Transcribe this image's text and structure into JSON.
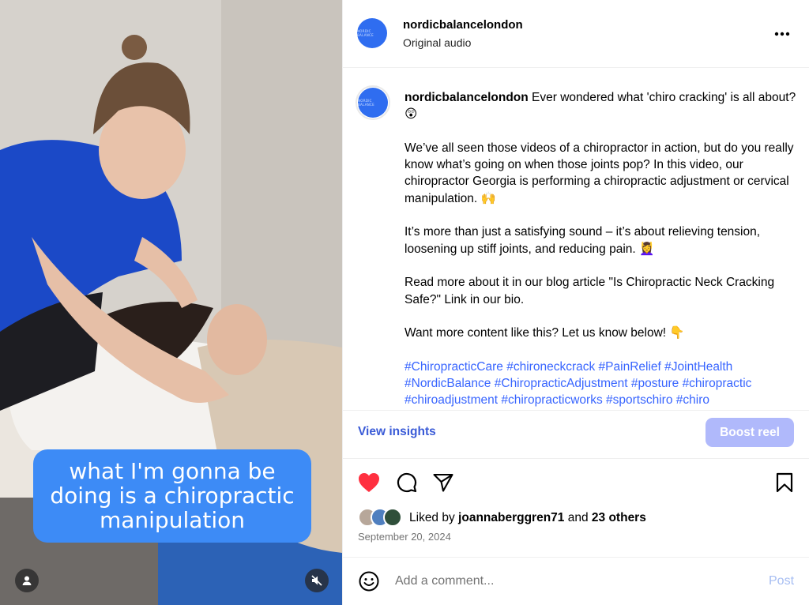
{
  "video": {
    "caption_lines": [
      "what I'm gonna be",
      "doing is a chiropractic",
      "manipulation"
    ],
    "user_icon": "user-icon",
    "mute_icon": "muted-speaker-icon"
  },
  "header": {
    "username": "nordicbalancelondon",
    "subtitle": "Original audio",
    "more_icon": "more-dots-icon"
  },
  "post": {
    "username": "nordicbalancelondon",
    "paragraphs": [
      "Ever wondered what 'chiro cracking' is all about? 😲",
      "We’ve all seen those videos of a chiropractor in action, but do you really know what’s going on when those joints pop? In this video, our chiropractor Georgia is performing a chiropractic adjustment or cervical manipulation. 🙌",
      "It’s more than just a satisfying sound – it’s about relieving tension, loosening up stiff joints, and reducing pain. 💆‍♀️",
      "Read more about it in our blog article \"Is Chiropractic Neck Cracking Safe?\" Link in our bio.",
      "Want more content like this? Let us know below! 👇"
    ],
    "hashtags": [
      "#ChiropracticCare",
      "#chironeckcrack",
      "#PainRelief",
      "#JointHealth",
      "#NordicBalance",
      "#ChiropracticAdjustment",
      "#posture",
      "#chiropractic",
      "#chiroadjustment",
      "#chiropracticworks",
      "#sportschiro",
      "#chiro"
    ]
  },
  "insights": {
    "view_label": "View insights",
    "boost_label": "Boost reel"
  },
  "likes": {
    "prefix": "Liked by",
    "user": "joannaberggren71",
    "conjunction": "and",
    "others": "23 others",
    "date": "September 20, 2024"
  },
  "comment": {
    "placeholder": "Add a comment...",
    "post_label": "Post"
  },
  "colors": {
    "accent": "#3865ff",
    "like_red": "#ff3040",
    "caption_blue": "#3d8bf6",
    "boost_disabled": "#b0b9fb"
  }
}
